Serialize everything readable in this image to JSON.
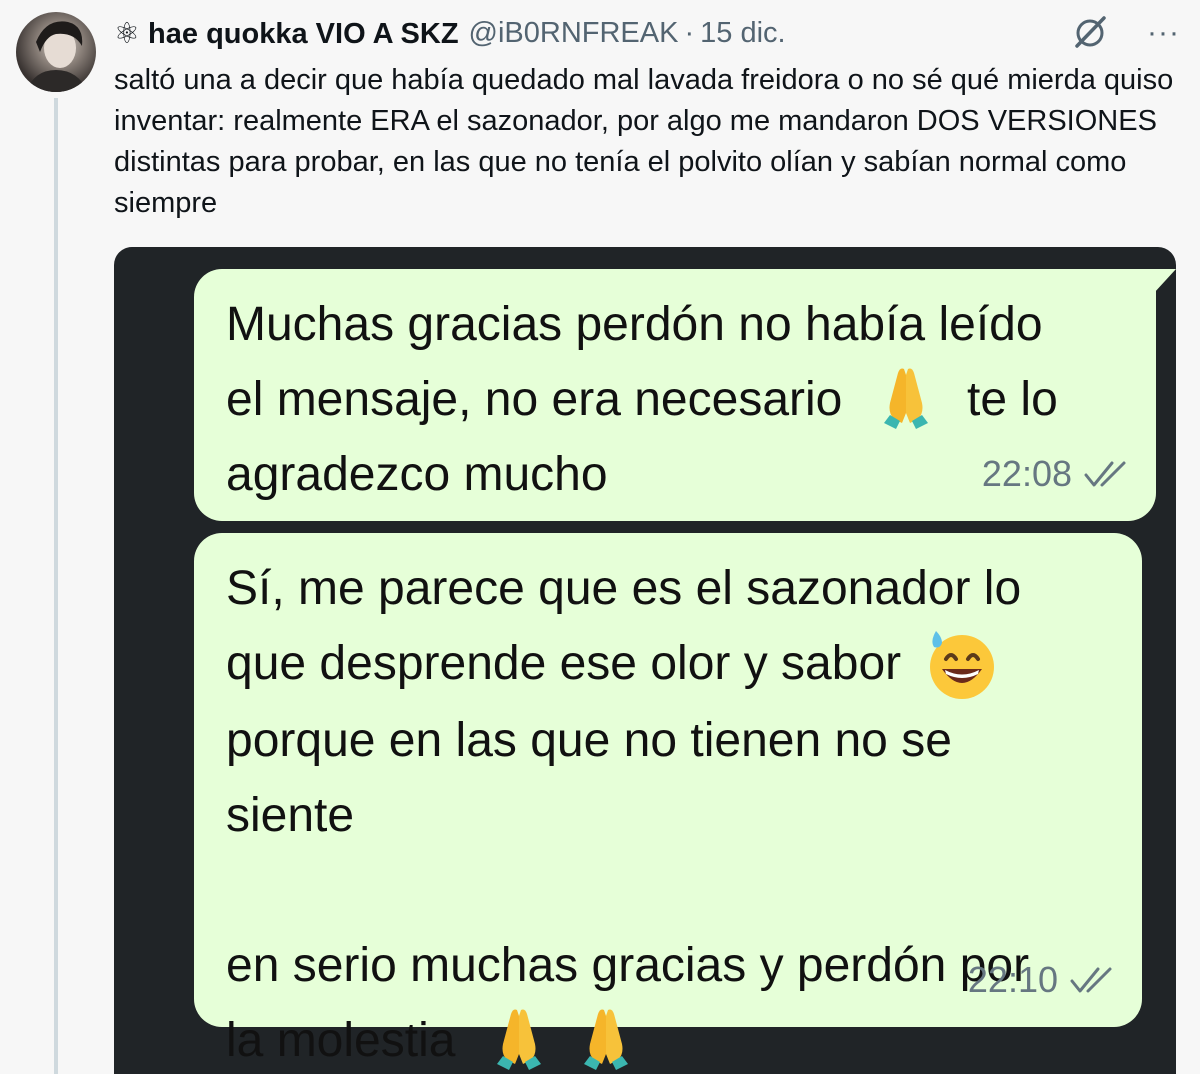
{
  "tweet": {
    "display_name": "⚛ hae quokka VIO A SKZ",
    "handle": "@iB0RNFREAK",
    "separator": "·",
    "date": "15 dic.",
    "more": "···",
    "text": "saltó una a decir que había quedado mal lavada freidora o no sé qué mierda quiso inventar: realmente ERA el sazonador, por algo me mandaron DOS VERSIONES distintas para probar, en las que no tenía el polvito olían y sabían normal como siempre"
  },
  "chat": {
    "messages": [
      {
        "line1": "Muchas gracias perdón no había leído",
        "line2a": "el mensaje, no era necesario",
        "emoji1": "folded-hands",
        "line2b": "te lo",
        "line3": "agradezco mucho",
        "time": "22:08"
      },
      {
        "line1": "Sí, me parece que es el sazonador lo",
        "line2": "que desprende ese olor y sabor",
        "emoji1": "grinning-face-with-sweat",
        "line3": "porque en las que no tienen no se",
        "line4": "siente",
        "line5": "en serio muchas gracias y perdón por",
        "line6": "la molestia",
        "emoji2": "folded-hands",
        "time": "22:10"
      }
    ],
    "colors": {
      "background": "#202427",
      "bubble": "#e6ffd8",
      "timestamp": "#667781"
    }
  }
}
